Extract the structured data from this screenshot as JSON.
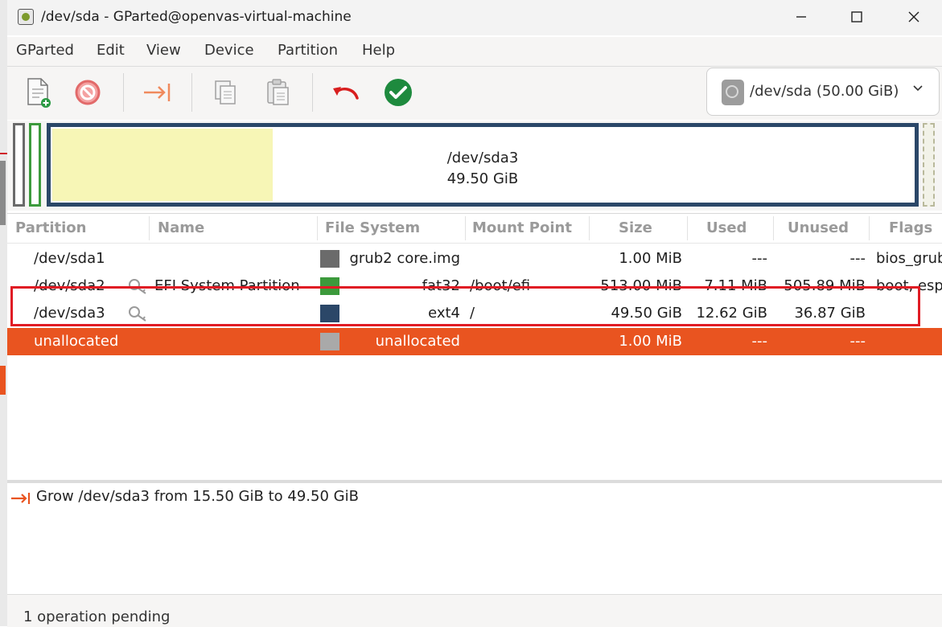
{
  "window": {
    "title": "/dev/sda - GParted@openvas-virtual-machine"
  },
  "menu": [
    "GParted",
    "Edit",
    "View",
    "Device",
    "Partition",
    "Help"
  ],
  "toolbar": {
    "buttons": [
      "new-partition",
      "delete",
      "resize-move",
      "copy",
      "paste",
      "undo",
      "apply"
    ],
    "device_selector": "/dev/sda (50.00 GiB)"
  },
  "graph": {
    "selected_name": "/dev/sda3",
    "selected_size": "49.50 GiB"
  },
  "table": {
    "columns": [
      "Partition",
      "Name",
      "File System",
      "Mount Point",
      "Size",
      "Used",
      "Unused",
      "Flags"
    ],
    "rows": [
      {
        "partition": "/dev/sda1",
        "name": "",
        "fs": "grub2 core.img",
        "mount": "",
        "size": "1.00 MiB",
        "used": "---",
        "unused": "---",
        "flags": "bios_grub",
        "fs_color": "#6b6b6b",
        "key": false
      },
      {
        "partition": "/dev/sda2",
        "name": "EFI System Partition",
        "fs": "fat32",
        "mount": "/boot/efi",
        "size": "513.00 MiB",
        "used": "7.11 MiB",
        "unused": "505.89 MiB",
        "flags": "boot, esp",
        "fs_color": "#3c9a3c",
        "key": true
      },
      {
        "partition": "/dev/sda3",
        "name": "",
        "fs": "ext4",
        "mount": "/",
        "size": "49.50 GiB",
        "used": "12.62 GiB",
        "unused": "36.87 GiB",
        "flags": "",
        "fs_color": "#2b4768",
        "key": true
      },
      {
        "partition": "unallocated",
        "name": "",
        "fs": "unallocated",
        "mount": "",
        "size": "1.00 MiB",
        "used": "---",
        "unused": "---",
        "flags": "",
        "fs_color": "#a9a9a9",
        "key": false
      }
    ]
  },
  "operations": {
    "items": [
      "Grow /dev/sda3 from 15.50 GiB to 49.50 GiB"
    ]
  },
  "status": {
    "text": "1 operation pending"
  },
  "colors": {
    "selection": "#e95420",
    "highlight_box": "#e01b24"
  }
}
